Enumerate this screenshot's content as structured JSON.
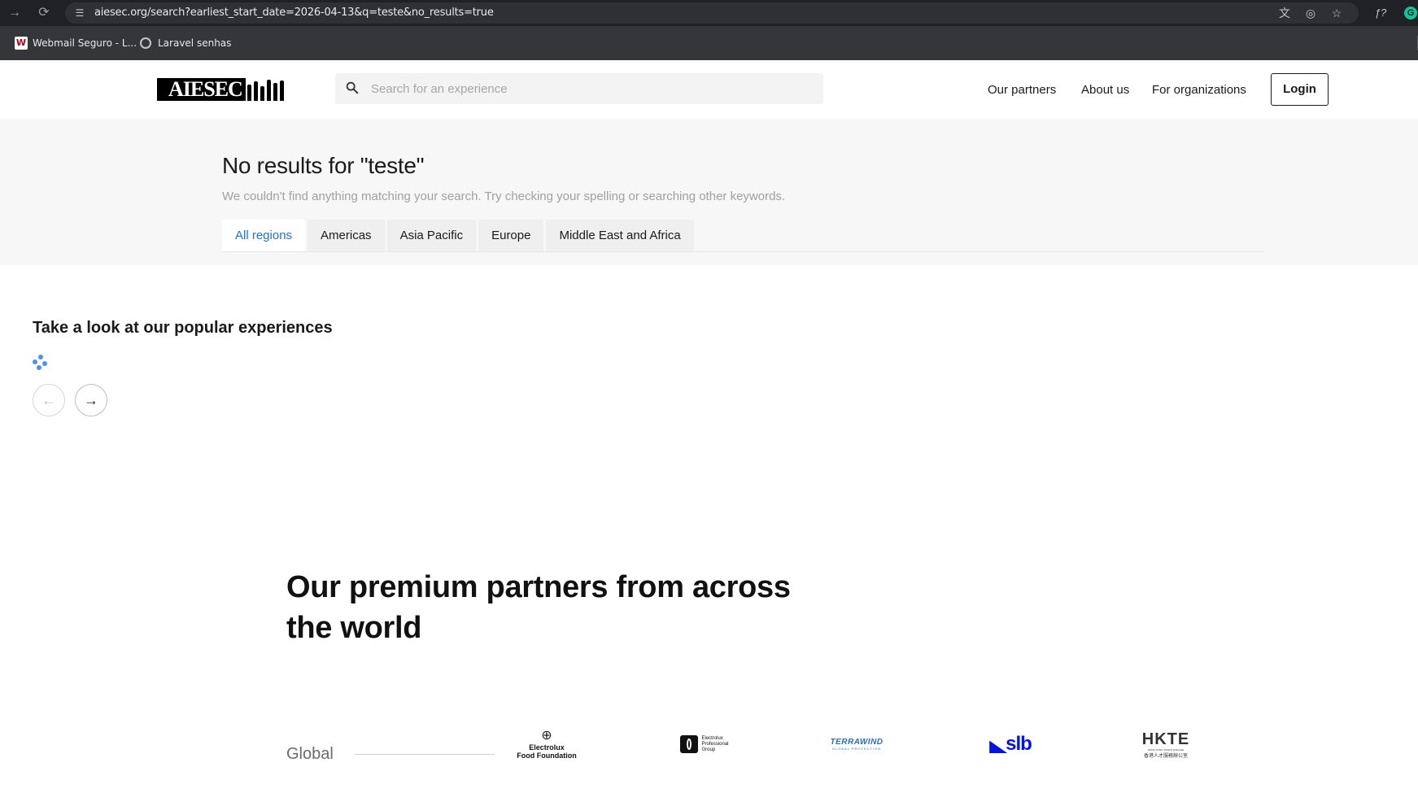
{
  "browser": {
    "url": "aiesec.org/search?earliest_start_date=2026-04-13&q=teste&no_results=true",
    "bookmarks": [
      {
        "label": "Webmail Seguro - L...",
        "icon": "webmail-w-icon"
      },
      {
        "label": "Laravel senhas",
        "icon": "globe-icon"
      }
    ]
  },
  "header": {
    "logo_text": "AIESEC",
    "search_placeholder": "Search for an experience",
    "search_value": "",
    "nav": [
      "Our partners",
      "About us",
      "For organizations"
    ],
    "login_label": "Login"
  },
  "results": {
    "title": "No results for \"teste\"",
    "subtitle": "We couldn't find anything matching your search. Try checking your spelling or searching other keywords.",
    "tabs": [
      "All regions",
      "Americas",
      "Asia Pacific",
      "Europe",
      "Middle East and Africa"
    ],
    "active_tab": "All regions"
  },
  "popular": {
    "title": "Take a look at our popular experiences"
  },
  "partners": {
    "title": "Our premium partners from across the world",
    "region_label": "Global",
    "logos": [
      {
        "name": "Electrolux Food Foundation",
        "line1": "Electrolux",
        "line2": "Food Foundation"
      },
      {
        "name": "Electrolux Professional Group",
        "line1": "Electrolux",
        "line2": "Professional",
        "line3": "Group"
      },
      {
        "name": "Terrawind",
        "line1": "TERRAWIND",
        "line2": "GLOBAL PROTECTION"
      },
      {
        "name": "slb",
        "line1": "slb"
      },
      {
        "name": "HKTE",
        "line1": "HKTE",
        "line2": "HONG KONG TALENT ENGAGE",
        "line3": "香港人才服務辦公室"
      }
    ]
  },
  "colors": {
    "accent_blue": "#1f6fd8",
    "chrome_dark": "#202124",
    "slb_blue": "#0014dc"
  }
}
